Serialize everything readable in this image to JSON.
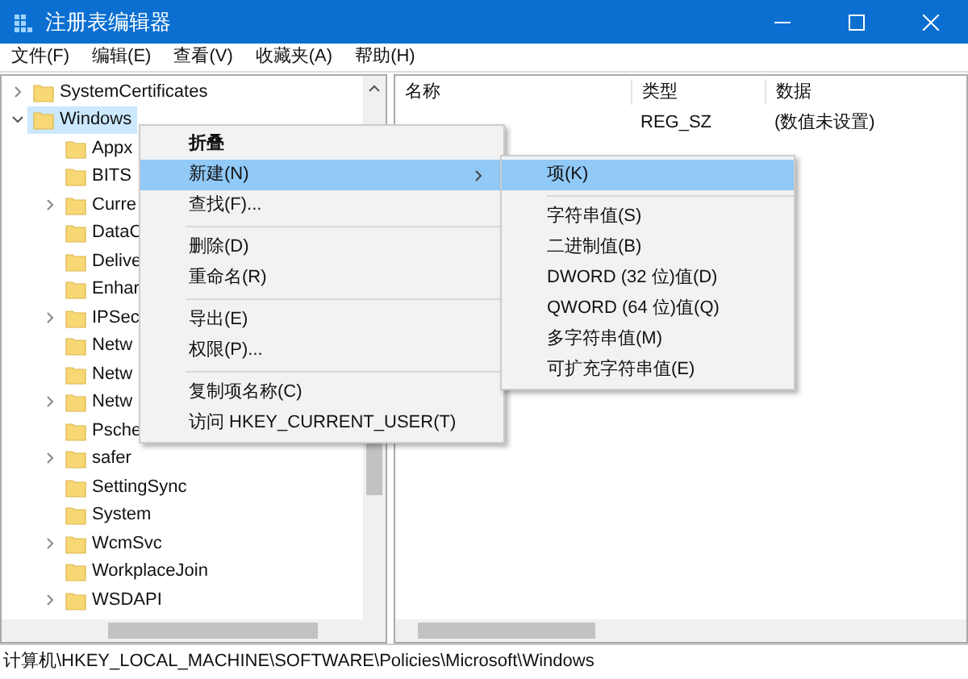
{
  "window": {
    "title": "注册表编辑器"
  },
  "menu_bar": [
    "文件(F)",
    "编辑(E)",
    "查看(V)",
    "收藏夹(A)",
    "帮助(H)"
  ],
  "tree": {
    "items": [
      {
        "label": "SystemCertificates",
        "has_children": true,
        "expanded": false,
        "selected": false
      },
      {
        "label": "Windows",
        "has_children": true,
        "expanded": true,
        "selected": true,
        "children": [
          {
            "label": "Appx",
            "has_children": false,
            "expanded": false,
            "selected": false
          },
          {
            "label": "BITS",
            "has_children": false,
            "expanded": false,
            "selected": false
          },
          {
            "label": "Curre",
            "has_children": true,
            "expanded": false,
            "selected": false
          },
          {
            "label": "DataC",
            "has_children": false,
            "expanded": false,
            "selected": false
          },
          {
            "label": "Delive",
            "has_children": false,
            "expanded": false,
            "selected": false
          },
          {
            "label": "Enhar",
            "has_children": false,
            "expanded": false,
            "selected": false
          },
          {
            "label": "IPSec",
            "has_children": true,
            "expanded": false,
            "selected": false
          },
          {
            "label": "Netw",
            "has_children": false,
            "expanded": false,
            "selected": false
          },
          {
            "label": "Netw",
            "has_children": false,
            "expanded": false,
            "selected": false
          },
          {
            "label": "Netw",
            "has_children": true,
            "expanded": false,
            "selected": false
          },
          {
            "label": "Psche",
            "has_children": false,
            "expanded": false,
            "selected": false
          },
          {
            "label": "safer",
            "has_children": true,
            "expanded": false,
            "selected": false
          },
          {
            "label": "SettingSync",
            "has_children": false,
            "expanded": false,
            "selected": false
          },
          {
            "label": "System",
            "has_children": false,
            "expanded": false,
            "selected": false
          },
          {
            "label": "WcmSvc",
            "has_children": true,
            "expanded": false,
            "selected": false
          },
          {
            "label": "WorkplaceJoin",
            "has_children": false,
            "expanded": false,
            "selected": false
          },
          {
            "label": "WSDAPI",
            "has_children": true,
            "expanded": false,
            "selected": false
          }
        ]
      }
    ]
  },
  "values": {
    "columns": [
      "名称",
      "类型",
      "数据"
    ],
    "rows": [
      {
        "type": "REG_SZ",
        "data": "(数值未设置)"
      }
    ]
  },
  "context_menu": {
    "items": [
      {
        "kind": "item",
        "label": "折叠",
        "bold": true,
        "selected": false,
        "submenu": false
      },
      {
        "kind": "item",
        "label": "新建(N)",
        "bold": false,
        "selected": true,
        "submenu": true
      },
      {
        "kind": "item",
        "label": "查找(F)...",
        "bold": false,
        "selected": false,
        "submenu": false
      },
      {
        "kind": "separator"
      },
      {
        "kind": "item",
        "label": "删除(D)",
        "bold": false,
        "selected": false,
        "submenu": false
      },
      {
        "kind": "item",
        "label": "重命名(R)",
        "bold": false,
        "selected": false,
        "submenu": false
      },
      {
        "kind": "separator"
      },
      {
        "kind": "item",
        "label": "导出(E)",
        "bold": false,
        "selected": false,
        "submenu": false
      },
      {
        "kind": "item",
        "label": "权限(P)...",
        "bold": false,
        "selected": false,
        "submenu": false
      },
      {
        "kind": "separator"
      },
      {
        "kind": "item",
        "label": "复制项名称(C)",
        "bold": false,
        "selected": false,
        "submenu": false
      },
      {
        "kind": "item",
        "label": "访问 HKEY_CURRENT_USER(T)",
        "bold": false,
        "selected": false,
        "submenu": false
      }
    ]
  },
  "submenu": {
    "items": [
      {
        "kind": "item",
        "label": "项(K)",
        "selected": true
      },
      {
        "kind": "separator"
      },
      {
        "kind": "item",
        "label": "字符串值(S)",
        "selected": false
      },
      {
        "kind": "item",
        "label": "二进制值(B)",
        "selected": false
      },
      {
        "kind": "item",
        "label": "DWORD (32 位)值(D)",
        "selected": false
      },
      {
        "kind": "item",
        "label": "QWORD (64 位)值(Q)",
        "selected": false
      },
      {
        "kind": "item",
        "label": "多字符串值(M)",
        "selected": false
      },
      {
        "kind": "item",
        "label": "可扩充字符串值(E)",
        "selected": false
      }
    ]
  },
  "status_bar": "计算机\\HKEY_LOCAL_MACHINE\\SOFTWARE\\Policies\\Microsoft\\Windows"
}
